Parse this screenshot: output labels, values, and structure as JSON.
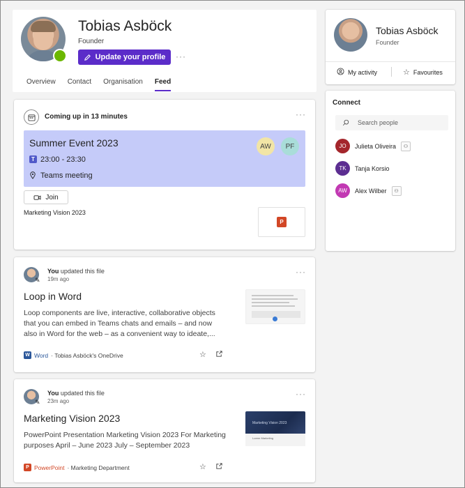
{
  "profile": {
    "name": "Tobias Asböck",
    "role": "Founder",
    "update_button": "Update your profile",
    "more": "···",
    "presence_color": "#6bb700",
    "tabs": [
      {
        "label": "Overview",
        "active": false
      },
      {
        "label": "Contact",
        "active": false
      },
      {
        "label": "Organisation",
        "active": false
      },
      {
        "label": "Feed",
        "active": true
      }
    ]
  },
  "event_card": {
    "heading": "Coming up in 13 minutes",
    "more": "···",
    "title": "Summer Event 2023",
    "time": "23:00 - 23:30",
    "location": "Teams meeting",
    "attendees": [
      "AW",
      "PF"
    ],
    "join_label": "Join",
    "attachment_label": "Marketing Vision 2023",
    "attachment_icon": "powerpoint-icon"
  },
  "feed": [
    {
      "actor": "You",
      "action": " updated this file",
      "time_ago": "19m ago",
      "title": "Loop in Word",
      "description": "Loop components are live, interactive, collaborative objects that you can embed in Teams chats and emails – and now also in Word for the web – as a convenient way to ideate,...",
      "app": "Word",
      "location": " · Tobias Asböck's OneDrive",
      "more": "···"
    },
    {
      "actor": "You",
      "action": " updated this file",
      "time_ago": "23m ago",
      "title": "Marketing Vision 2023",
      "description": "PowerPoint Presentation Marketing Vision 2023 For Marketing purposes April – June 2023 July – September 2023",
      "app": "PowerPoint",
      "location": " · Marketing Department",
      "thumb_title": "Marketing Vision 2023",
      "thumb_sub": "Lorem Marketing",
      "more": "···"
    }
  ],
  "side_profile": {
    "name": "Tobias Asböck",
    "role": "Founder",
    "my_activity": "My activity",
    "favourites": "Favourites"
  },
  "connect": {
    "title": "Connect",
    "search_placeholder": "Search people",
    "people": [
      {
        "initials": "JO",
        "name": "Julieta Oliveira",
        "color": "#a4262c",
        "chip": true
      },
      {
        "initials": "TK",
        "name": "Tanja Korsio",
        "color": "#5c2e91",
        "chip": false
      },
      {
        "initials": "AW",
        "name": "Alex Wilber",
        "color": "#c239b3",
        "chip": true
      }
    ]
  },
  "colors": {
    "accent": "#5b2cc9",
    "event_bg": "#c5cbf9",
    "word": "#2b579a",
    "powerpoint": "#d24726"
  }
}
